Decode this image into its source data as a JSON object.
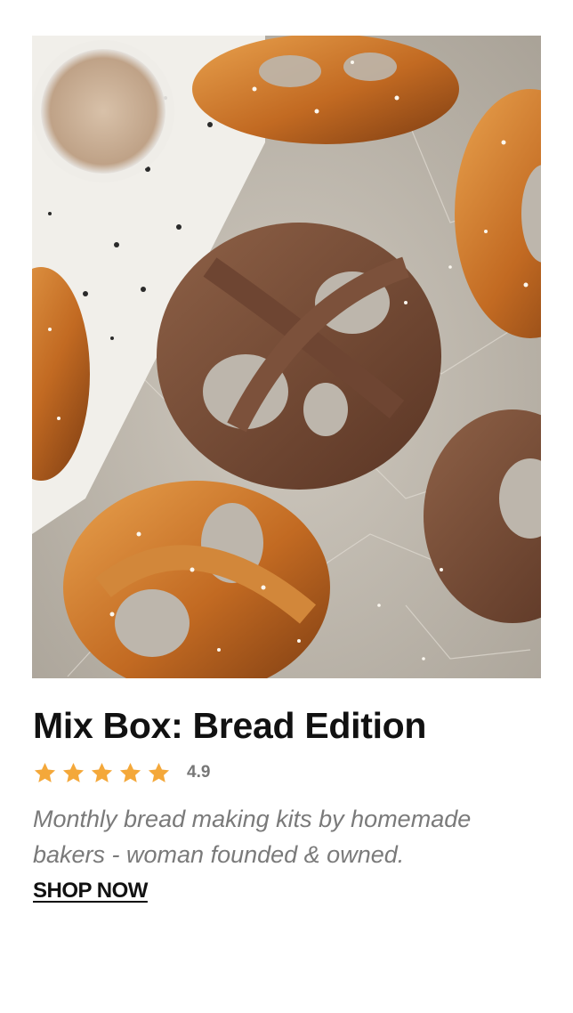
{
  "product": {
    "image_alt": "Soft pretzels with salt and cinnamon sugar on parchment paper",
    "title": "Mix Box: Bread Edition",
    "rating": {
      "value": "4.9",
      "stars": 5,
      "star_color": "#f4a83a"
    },
    "description": "Monthly bread making kits by homemade bakers - woman founded & owned.",
    "cta_label": "SHOP NOW"
  }
}
